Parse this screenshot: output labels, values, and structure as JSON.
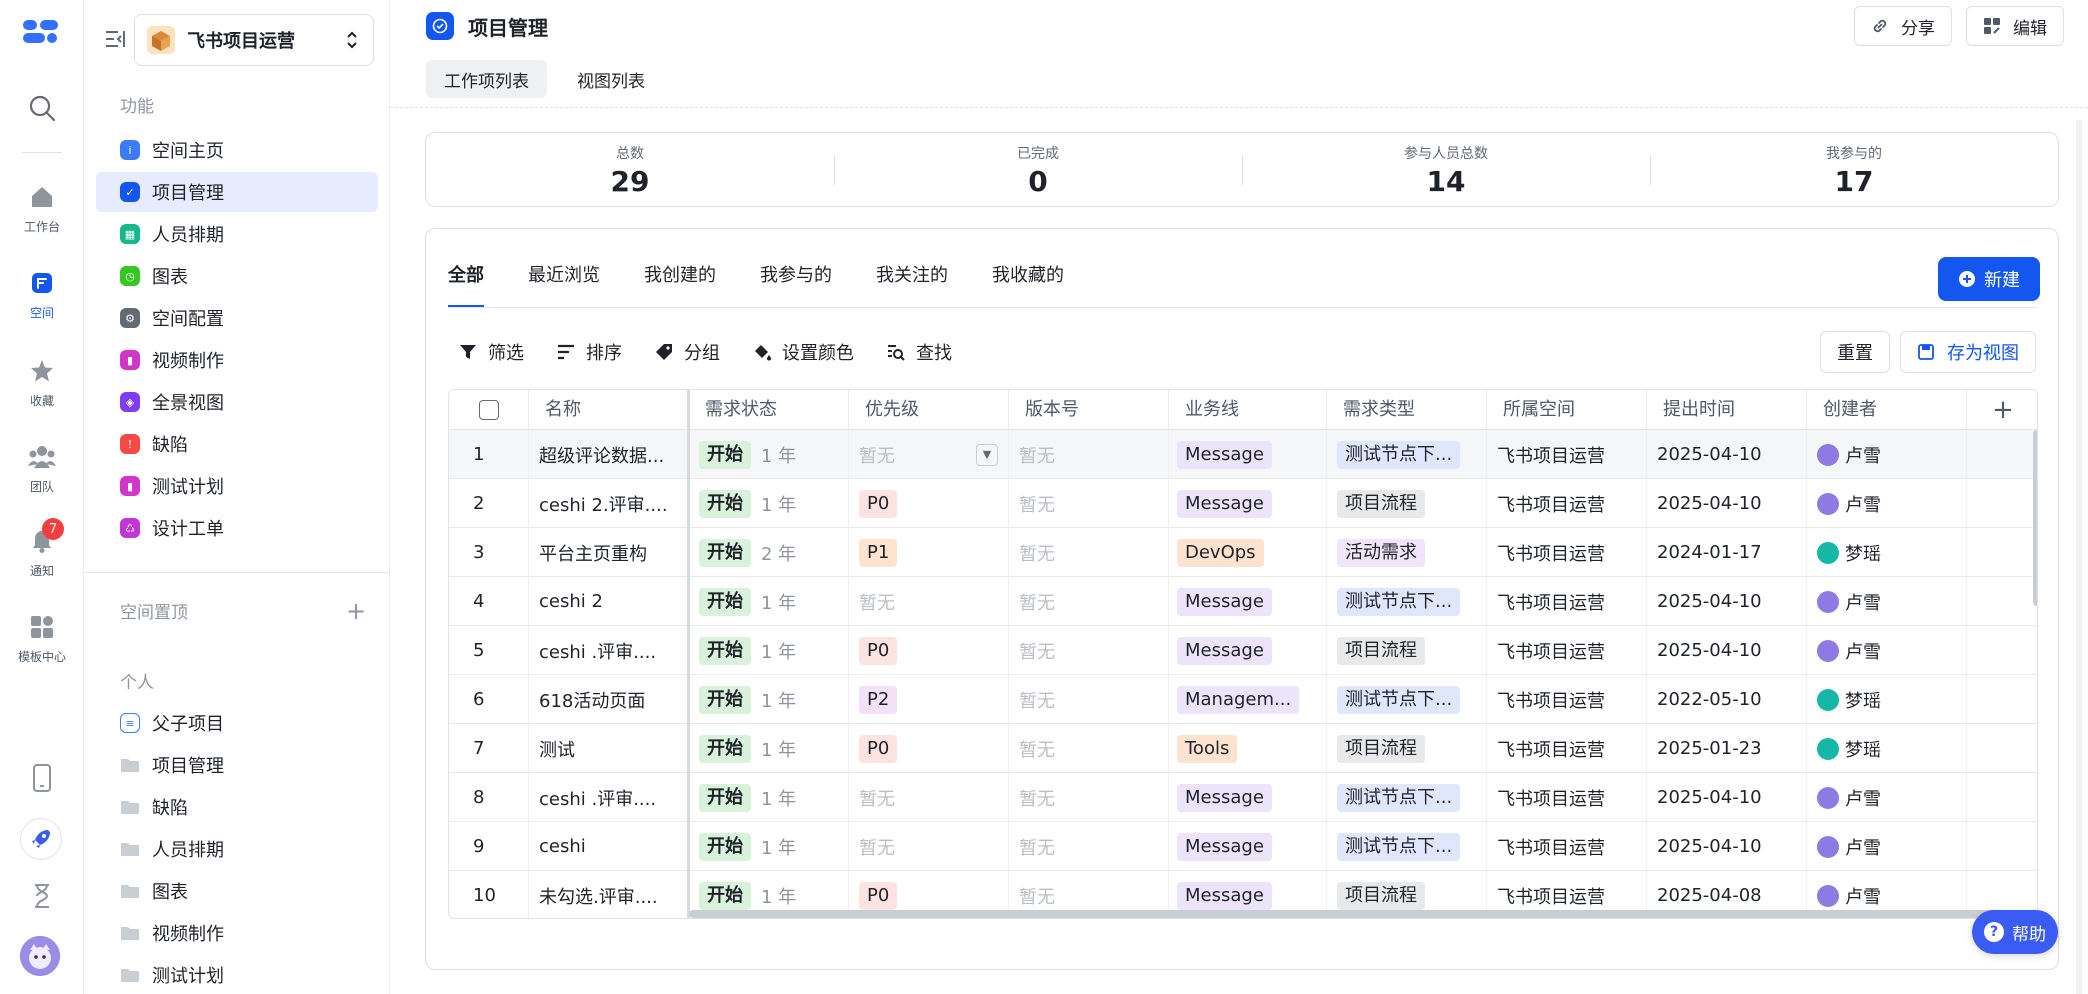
{
  "rail": {
    "items": [
      {
        "label": "工作台",
        "icon": "home-icon"
      },
      {
        "label": "空间",
        "icon": "space-icon"
      },
      {
        "label": "收藏",
        "icon": "star-icon"
      },
      {
        "label": "团队",
        "icon": "team-icon"
      },
      {
        "label": "通知",
        "icon": "bell-icon",
        "badge": "7"
      },
      {
        "label": "模板中心",
        "icon": "template-icon"
      }
    ]
  },
  "sidebar": {
    "space_name": "飞书项目运营",
    "section_function": "功能",
    "items": [
      {
        "label": "空间主页",
        "color": "#3b7bf6"
      },
      {
        "label": "项目管理",
        "color": "#1456f0"
      },
      {
        "label": "人员排期",
        "color": "#14b88a"
      },
      {
        "label": "图表",
        "color": "#34c724"
      },
      {
        "label": "空间配置",
        "color": "#646a73"
      },
      {
        "label": "视频制作",
        "color": "#d136c8"
      },
      {
        "label": "全景视图",
        "color": "#7f3bf5"
      },
      {
        "label": "缺陷",
        "color": "#f54a45"
      },
      {
        "label": "测试计划",
        "color": "#d136c8"
      },
      {
        "label": "设计工单",
        "color": "#c236d6"
      }
    ],
    "section_pinned": "空间置顶",
    "section_personal": "个人",
    "personal_items": [
      {
        "label": "父子项目"
      },
      {
        "label": "项目管理"
      },
      {
        "label": "缺陷"
      },
      {
        "label": "人员排期"
      },
      {
        "label": "图表"
      },
      {
        "label": "视频制作"
      },
      {
        "label": "测试计划"
      }
    ]
  },
  "header": {
    "title": "项目管理",
    "share_label": "分享",
    "edit_label": "编辑",
    "tabs": [
      {
        "label": "工作项列表"
      },
      {
        "label": "视图列表"
      }
    ]
  },
  "stats": [
    {
      "label": "总数",
      "value": "29"
    },
    {
      "label": "已完成",
      "value": "0"
    },
    {
      "label": "参与人员总数",
      "value": "14"
    },
    {
      "label": "我参与的",
      "value": "17"
    }
  ],
  "filter_tabs": [
    {
      "label": "全部"
    },
    {
      "label": "最近浏览"
    },
    {
      "label": "我创建的"
    },
    {
      "label": "我参与的"
    },
    {
      "label": "我关注的"
    },
    {
      "label": "我收藏的"
    }
  ],
  "new_label": "新建",
  "toolbar": {
    "filter": "筛选",
    "sort": "排序",
    "group": "分组",
    "color": "设置颜色",
    "find": "查找",
    "reset": "重置",
    "save_view": "存为视图"
  },
  "table": {
    "columns": [
      "名称",
      "需求状态",
      "优先级",
      "版本号",
      "业务线",
      "需求类型",
      "所属空间",
      "提出时间",
      "创建者"
    ],
    "rows": [
      {
        "no": "1",
        "name": "超级评论数据...",
        "status": "开始",
        "dur": "1 年",
        "priority": "暂无",
        "version": "暂无",
        "biz": "Message",
        "type": "测试节点下...",
        "space": "飞书项目运营",
        "date": "2025-04-10",
        "creator": "卢雪"
      },
      {
        "no": "2",
        "name": "ceshi 2.评审....",
        "status": "开始",
        "dur": "1 年",
        "priority": "P0",
        "version": "暂无",
        "biz": "Message",
        "type": "项目流程",
        "space": "飞书项目运营",
        "date": "2025-04-10",
        "creator": "卢雪"
      },
      {
        "no": "3",
        "name": "平台主页重构",
        "status": "开始",
        "dur": "2 年",
        "priority": "P1",
        "version": "暂无",
        "biz": "DevOps",
        "type": "活动需求",
        "space": "飞书项目运营",
        "date": "2024-01-17",
        "creator": "梦瑶"
      },
      {
        "no": "4",
        "name": "ceshi 2",
        "status": "开始",
        "dur": "1 年",
        "priority": "暂无",
        "version": "暂无",
        "biz": "Message",
        "type": "测试节点下...",
        "space": "飞书项目运营",
        "date": "2025-04-10",
        "creator": "卢雪"
      },
      {
        "no": "5",
        "name": "ceshi .评审....",
        "status": "开始",
        "dur": "1 年",
        "priority": "P0",
        "version": "暂无",
        "biz": "Message",
        "type": "项目流程",
        "space": "飞书项目运营",
        "date": "2025-04-10",
        "creator": "卢雪"
      },
      {
        "no": "6",
        "name": "618活动页面",
        "status": "开始",
        "dur": "1 年",
        "priority": "P2",
        "version": "暂无",
        "biz": "Managem...",
        "type": "测试节点下...",
        "space": "飞书项目运营",
        "date": "2022-05-10",
        "creator": "梦瑶"
      },
      {
        "no": "7",
        "name": "测试",
        "status": "开始",
        "dur": "1 年",
        "priority": "P0",
        "version": "暂无",
        "biz": "Tools",
        "type": "项目流程",
        "space": "飞书项目运营",
        "date": "2025-01-23",
        "creator": "梦瑶"
      },
      {
        "no": "8",
        "name": "ceshi .评审....",
        "status": "开始",
        "dur": "1 年",
        "priority": "暂无",
        "version": "暂无",
        "biz": "Message",
        "type": "测试节点下...",
        "space": "飞书项目运营",
        "date": "2025-04-10",
        "creator": "卢雪"
      },
      {
        "no": "9",
        "name": "ceshi",
        "status": "开始",
        "dur": "1 年",
        "priority": "暂无",
        "version": "暂无",
        "biz": "Message",
        "type": "测试节点下...",
        "space": "飞书项目运营",
        "date": "2025-04-10",
        "creator": "卢雪"
      },
      {
        "no": "10",
        "name": "未勾选.评审....",
        "status": "开始",
        "dur": "1 年",
        "priority": "P0",
        "version": "暂无",
        "biz": "Message",
        "type": "项目流程",
        "space": "飞书项目运营",
        "date": "2025-04-08",
        "creator": "卢雪"
      }
    ]
  },
  "help_label": "帮助"
}
